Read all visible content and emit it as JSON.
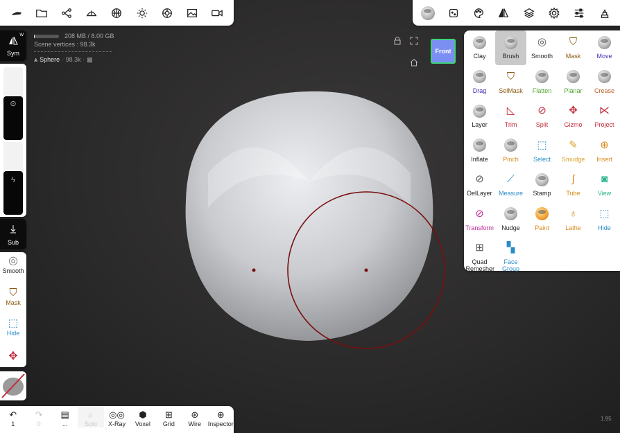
{
  "app": {
    "top_left_icons": [
      "hand-icon",
      "folder-icon",
      "scene-graph-icon",
      "topology-icon",
      "grid-sphere-icon",
      "sun-icon",
      "material-icon",
      "image-icon",
      "camera-icon"
    ],
    "top_right_icons": [
      "brush-sphere-icon",
      "stroke-icon",
      "palette-icon",
      "symmetry-icon",
      "layers-icon",
      "settings-icon",
      "sliders-icon",
      "export-icon"
    ]
  },
  "stats": {
    "memory": "208 MB / 8.00 GB",
    "memory_fraction": 0.03,
    "scene_vertices": "Scene vertices : 98.3k",
    "mesh_name": "Sphere",
    "mesh_info": "· 98.3k ·"
  },
  "viewport": {
    "camera_label": "Front",
    "colors": {
      "cube": "#7b8ff3",
      "cube_edge": "#3ed37a",
      "mesh": "#d4d6da",
      "brush_circle": "#7a0f0f"
    }
  },
  "sidebar": {
    "sym_label": "Sym",
    "sym_sup": "W",
    "radius_slider_fraction": 0.6,
    "intensity_slider_fraction": 0.6,
    "sub_label": "Sub",
    "quick_tools": [
      {
        "label": "Smooth",
        "icon": "smooth-icon",
        "color": "#222222"
      },
      {
        "label": "Mask",
        "icon": "mask-icon",
        "color": "#8a5a12"
      },
      {
        "label": "Hide",
        "icon": "hide-icon",
        "color": "#2a8bc9"
      }
    ]
  },
  "bottombar": [
    {
      "label": "1",
      "icon": "undo-icon",
      "disabled": false
    },
    {
      "label": "0",
      "icon": "redo-icon",
      "disabled": true
    },
    {
      "label": "...",
      "icon": "history-icon",
      "disabled": false
    },
    {
      "label": "Solo",
      "icon": "solo-icon",
      "disabled": true
    },
    {
      "label": "X-Ray",
      "icon": "xray-icon",
      "disabled": false
    },
    {
      "label": "Voxel",
      "icon": "voxel-icon",
      "disabled": false
    },
    {
      "label": "Grid",
      "icon": "grid-icon",
      "disabled": false
    },
    {
      "label": "Wire",
      "icon": "wire-icon",
      "disabled": false
    },
    {
      "label": "Inspector",
      "icon": "inspector-icon",
      "disabled": false
    }
  ],
  "version": "1.95",
  "tools": [
    {
      "label": "Clay",
      "color": "#222222",
      "icon": "clay-icon",
      "kind": "sphere"
    },
    {
      "label": "Brush",
      "color": "#222222",
      "icon": "brush-icon",
      "kind": "sphere",
      "active": true
    },
    {
      "label": "Smooth",
      "color": "#222222",
      "icon": "smooth-icon",
      "kind": "glyph",
      "glyph": "◎"
    },
    {
      "label": "Mask",
      "color": "#8a5a12",
      "icon": "mask-icon",
      "kind": "glyph",
      "glyph": "⛉"
    },
    {
      "label": "Move",
      "color": "#3b2fb5",
      "icon": "move-icon",
      "kind": "sphere"
    },
    {
      "label": "Drag",
      "color": "#3b2fb5",
      "icon": "drag-icon",
      "kind": "sphere"
    },
    {
      "label": "SelMask",
      "color": "#8a5a12",
      "icon": "selmask-icon",
      "kind": "glyph",
      "glyph": "⛉"
    },
    {
      "label": "Flatten",
      "color": "#4aa32a",
      "icon": "flatten-icon",
      "kind": "sphere"
    },
    {
      "label": "Planar",
      "color": "#4aa32a",
      "icon": "planar-icon",
      "kind": "sphere"
    },
    {
      "label": "Crease",
      "color": "#c0602a",
      "icon": "crease-icon",
      "kind": "sphere"
    },
    {
      "label": "Layer",
      "color": "#222222",
      "icon": "layer-icon",
      "kind": "sphere"
    },
    {
      "label": "Trim",
      "color": "#c22a3a",
      "icon": "trim-icon",
      "kind": "glyph",
      "glyph": "◺"
    },
    {
      "label": "Split",
      "color": "#c22a3a",
      "icon": "split-icon",
      "kind": "glyph",
      "glyph": "⊘"
    },
    {
      "label": "Gizmo",
      "color": "#c22a3a",
      "icon": "gizmo-icon",
      "kind": "glyph",
      "glyph": "✥"
    },
    {
      "label": "Project",
      "color": "#c22a3a",
      "icon": "project-icon",
      "kind": "glyph",
      "glyph": "⋉"
    },
    {
      "label": "Inflate",
      "color": "#222222",
      "icon": "inflate-icon",
      "kind": "sphere"
    },
    {
      "label": "Pinch",
      "color": "#d88a1a",
      "icon": "pinch-icon",
      "kind": "sphere"
    },
    {
      "label": "Select",
      "color": "#2a8bc9",
      "icon": "select-icon",
      "kind": "glyph",
      "glyph": "⬚"
    },
    {
      "label": "Smudge",
      "color": "#d8a12a",
      "icon": "smudge-icon",
      "kind": "glyph",
      "glyph": "✎"
    },
    {
      "label": "Insert",
      "color": "#d88a1a",
      "icon": "insert-icon",
      "kind": "glyph",
      "glyph": "⊕"
    },
    {
      "label": "DelLayer",
      "color": "#222222",
      "icon": "dellayer-icon",
      "kind": "glyph",
      "glyph": "⊘"
    },
    {
      "label": "Measure",
      "color": "#2a8bc9",
      "icon": "measure-icon",
      "kind": "glyph",
      "glyph": "⟋"
    },
    {
      "label": "Stamp",
      "color": "#222222",
      "icon": "stamp-icon",
      "kind": "sphere"
    },
    {
      "label": "Tube",
      "color": "#d88a1a",
      "icon": "tube-icon",
      "kind": "glyph",
      "glyph": "∫"
    },
    {
      "label": "View",
      "color": "#2ab28a",
      "icon": "view-icon",
      "kind": "glyph",
      "glyph": "◙"
    },
    {
      "label": "Transform",
      "color": "#c02a9a",
      "icon": "transform-icon",
      "kind": "glyph",
      "glyph": "⊘"
    },
    {
      "label": "Nudge",
      "color": "#222222",
      "icon": "nudge-icon",
      "kind": "sphere"
    },
    {
      "label": "Paint",
      "color": "#d88a1a",
      "icon": "paint-icon",
      "kind": "sphere"
    },
    {
      "label": "Lathe",
      "color": "#d88a1a",
      "icon": "lathe-icon",
      "kind": "glyph",
      "glyph": "♁"
    },
    {
      "label": "Hide",
      "color": "#2a8bc9",
      "icon": "hide-icon",
      "kind": "glyph",
      "glyph": "⬚"
    },
    {
      "label": "Quad Remesher",
      "color": "#222222",
      "icon": "quad-remesher-icon",
      "kind": "glyph",
      "glyph": "⊞"
    },
    {
      "label": "Face Group",
      "color": "#2a8bc9",
      "icon": "face-group-icon",
      "kind": "glyph",
      "glyph": "▚"
    }
  ]
}
